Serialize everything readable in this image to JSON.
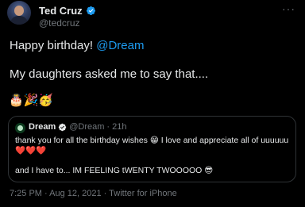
{
  "author": {
    "display_name": "Ted Cruz",
    "handle": "@tedcruz",
    "verified": true
  },
  "tweet": {
    "line1_text": "Happy birthday! ",
    "line1_mention": "@Dream",
    "line2_text": "My daughters asked me to say that....",
    "emojis": "🎂🎉🥳"
  },
  "quote": {
    "display_name": "Dream",
    "handle": "@Dream",
    "separator": "·",
    "time": "21h",
    "text1": "thank you for all the birthday wishes 😁 I love and appreciate all of uuuuuu❤️❤️❤️",
    "text2": "and I have to... IM FEELING tWENTY TWOOOOO 😎"
  },
  "meta": {
    "timestamp": "7:25 PM · Aug 12, 2021 · Twitter for iPhone"
  },
  "more_icon": "more-horizontal-icon",
  "colors": {
    "background": "#000000",
    "text": "#e7e9ea",
    "secondary": "#71767b",
    "link": "#1d9bf0",
    "verified": "#1d9bf0",
    "border": "#2f3336"
  }
}
